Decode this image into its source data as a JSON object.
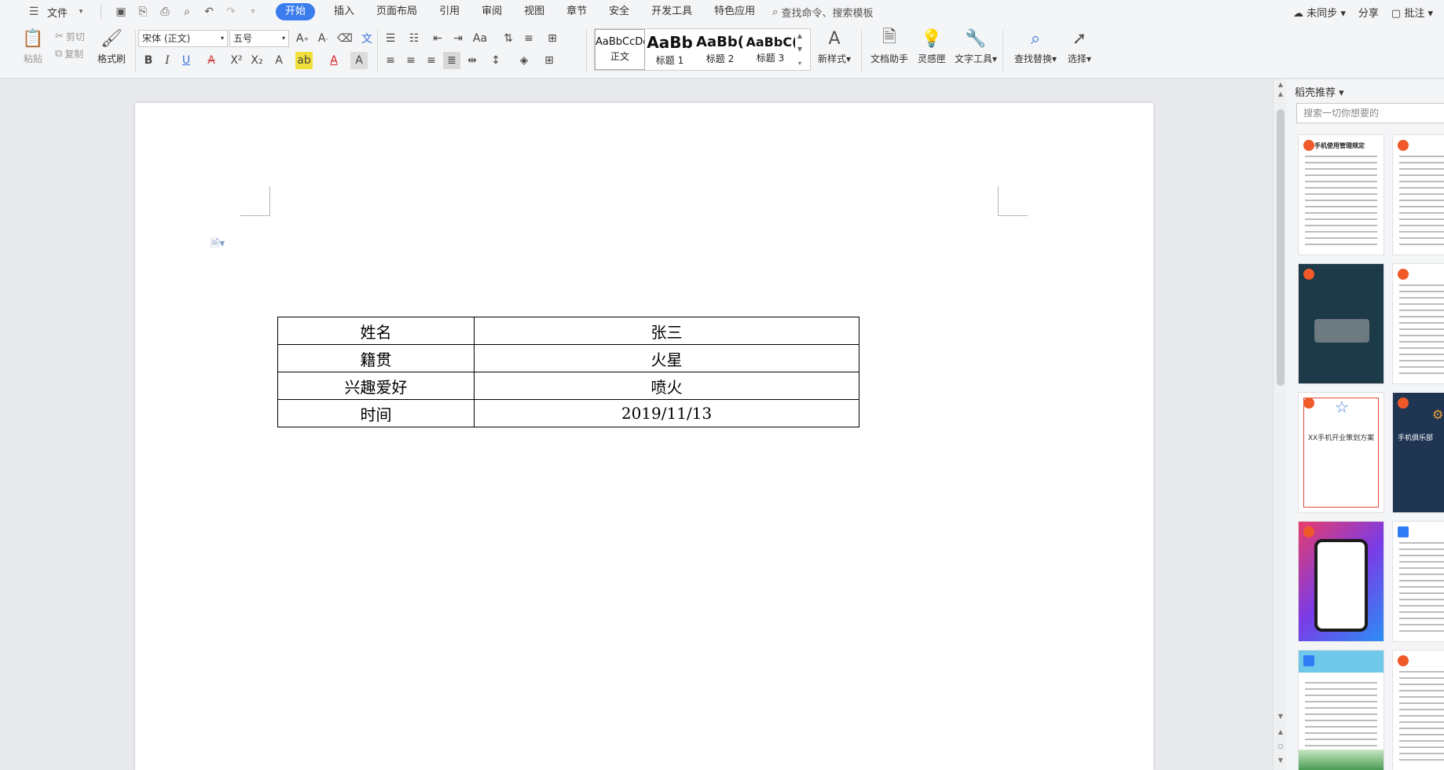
{
  "menubar": {
    "file": "文件",
    "tabs": [
      "开始",
      "插入",
      "页面布局",
      "引用",
      "审阅",
      "视图",
      "章节",
      "安全",
      "开发工具",
      "特色应用"
    ],
    "search": "查找命令、搜索模板",
    "right": {
      "sync": "未同步",
      "share": "分享",
      "comment": "批注"
    }
  },
  "ribbon": {
    "paste": "粘贴",
    "cut": "剪切",
    "copy": "复制",
    "format_painter": "格式刷",
    "font_name": "宋体 (正文)",
    "font_size": "五号",
    "styles": [
      {
        "preview": "AaBbCcDd",
        "name": "正文"
      },
      {
        "preview": "AaBb",
        "name": "标题 1"
      },
      {
        "preview": "AaBb(",
        "name": "标题 2"
      },
      {
        "preview": "AaBbC(",
        "name": "标题 3"
      }
    ],
    "new_style": "新样式",
    "doc_assistant": "文档助手",
    "inspiration": "灵感匣",
    "text_tools": "文字工具",
    "find_replace": "查找替换",
    "select": "选择"
  },
  "table": {
    "rows": [
      [
        "姓名",
        "张三"
      ],
      [
        "籍贯",
        "火星"
      ],
      [
        "兴趣爱好",
        "喷火"
      ],
      [
        "时间",
        "2019/11/13"
      ]
    ]
  },
  "rightpane": {
    "title": "稻壳推荐",
    "search_placeholder": "搜索一切你想要的",
    "thumb_titles": {
      "t1": "手机使用管理规定",
      "t5": "XX手机开业策划方案",
      "t6": "手机俱乐部"
    }
  }
}
